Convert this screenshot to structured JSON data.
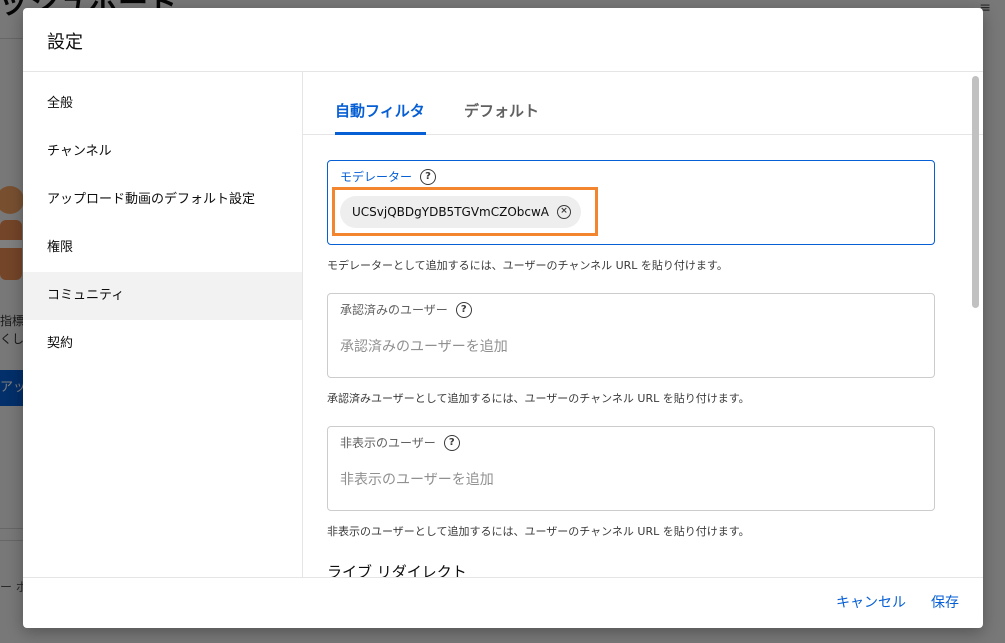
{
  "background": {
    "title": "ッシュボード",
    "text1": "指標",
    "text2": "くし",
    "button_label": "アッ",
    "footer_text": "ー ポ",
    "menu_icon": "≡"
  },
  "dialog": {
    "title": "設定",
    "sidebar": {
      "items": [
        {
          "label": "全般"
        },
        {
          "label": "チャンネル"
        },
        {
          "label": "アップロード動画のデフォルト設定"
        },
        {
          "label": "権限"
        },
        {
          "label": "コミュニティ"
        },
        {
          "label": "契約"
        }
      ]
    },
    "tabs": [
      {
        "label": "自動フィルタ"
      },
      {
        "label": "デフォルト"
      }
    ],
    "moderators": {
      "label": "モデレーター",
      "chip": "UCSvjQBDgYDB5TGVmCZObcwA",
      "hint": "モデレーターとして追加するには、ユーザーのチャンネル URL を貼り付けます。"
    },
    "approved": {
      "label": "承認済みのユーザー",
      "placeholder": "承認済みのユーザーを追加",
      "hint": "承認済みユーザーとして追加するには、ユーザーのチャンネル URL を貼り付けます。"
    },
    "hidden": {
      "label": "非表示のユーザー",
      "placeholder": "非表示のユーザーを追加",
      "hint": "非表示のユーザーとして追加するには、ユーザーのチャンネル URL を貼り付けます。"
    },
    "live_redirect": "ライブ リダイレクト",
    "help_glyph": "?",
    "remove_glyph": "×",
    "cancel_label": "キャンセル",
    "save_label": "保存"
  },
  "colors": {
    "accent": "#065fd4",
    "highlight": "#f2852d"
  },
  "icons": [
    "help-icon",
    "remove-chip-icon",
    "menu-icon"
  ]
}
